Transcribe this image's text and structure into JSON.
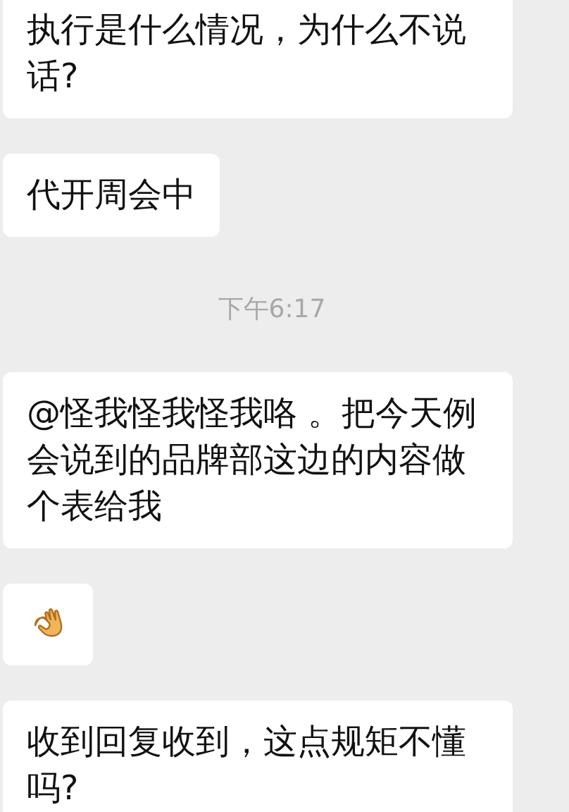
{
  "messages": [
    {
      "kind": "text",
      "text": "执行是什么情况，为什么不说话?"
    },
    {
      "kind": "text",
      "text": "代开周会中"
    },
    {
      "kind": "time",
      "text": "下午6:17"
    },
    {
      "kind": "text",
      "text": "@怪我怪我怪我咯 。把今天例会说到的品牌部这边的内容做个表给我"
    },
    {
      "kind": "sticker"
    },
    {
      "kind": "text",
      "text": "收到回复收到，这点规矩不懂吗?"
    }
  ]
}
